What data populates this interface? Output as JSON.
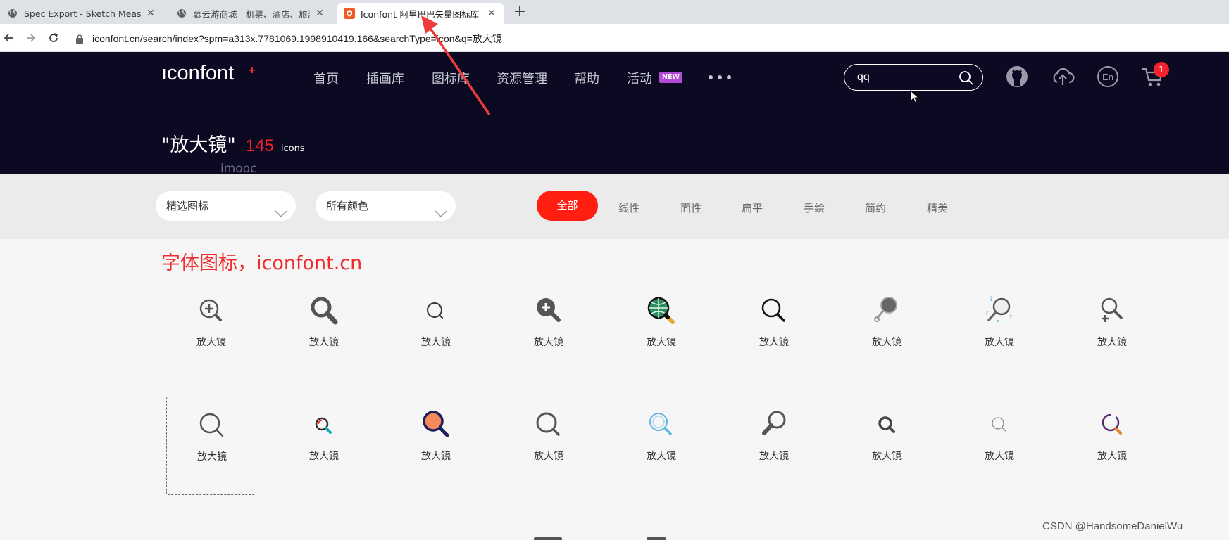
{
  "browser": {
    "tabs": [
      {
        "title": "Spec Export - Sketch Measure",
        "favicon": "globe-icon",
        "active": false
      },
      {
        "title": "慕云游商城 - 机票、酒店、旅游",
        "favicon": "globe-icon",
        "active": false
      },
      {
        "title": "Iconfont-阿里巴巴矢量图标库",
        "favicon": "iconfont-favicon",
        "active": true
      }
    ],
    "new_tab": "+",
    "url": "iconfont.cn/search/index?spm=a313x.7781069.1998910419.166&searchType=icon&q=放大镜"
  },
  "header": {
    "logo": "ıconfont",
    "logo_plus": "+",
    "nav": [
      "首页",
      "插画库",
      "图标库",
      "资源管理",
      "帮助",
      "活动"
    ],
    "new_badge": "NEW",
    "search_value": "qq",
    "cart_count": "1",
    "icons": [
      "github-icon",
      "upload-icon",
      "language-en-icon",
      "cart-icon"
    ]
  },
  "result": {
    "keyword": "\"放大镜\"",
    "count": "145",
    "unit": "icons",
    "watermark": "imooc"
  },
  "filters": {
    "select_type": "精选图标",
    "select_color": "所有颜色",
    "style_tabs": [
      "全部",
      "线性",
      "面性",
      "扁平",
      "手绘",
      "简约",
      "精美"
    ],
    "active_tab": "全部"
  },
  "annotation": "字体图标，iconfont.cn",
  "icons": [
    {
      "label": "放大镜",
      "icon": "magnifier-plus-icon"
    },
    {
      "label": "放大镜",
      "icon": "magnifier-bold-icon"
    },
    {
      "label": "放大镜",
      "icon": "magnifier-thin-icon"
    },
    {
      "label": "放大镜",
      "icon": "magnifier-plus-filled-icon"
    },
    {
      "label": "放大镜",
      "icon": "magnifier-globe-icon"
    },
    {
      "label": "放大镜",
      "icon": "magnifier-outline-icon"
    },
    {
      "label": "放大镜",
      "icon": "magnifier-gray-filled-icon"
    },
    {
      "label": "放大镜",
      "icon": "magnifier-question-icon"
    },
    {
      "label": "放大镜",
      "icon": "magnifier-plus-small-icon"
    },
    {
      "label": "放大镜",
      "icon": "magnifier-line-icon"
    },
    {
      "label": "放大镜",
      "icon": "magnifier-teal-icon"
    },
    {
      "label": "放大镜",
      "icon": "magnifier-orange-icon"
    },
    {
      "label": "放大镜",
      "icon": "magnifier-gray-icon"
    },
    {
      "label": "放大镜",
      "icon": "magnifier-lightblue-icon"
    },
    {
      "label": "放大镜",
      "icon": "magnifier-handle-icon"
    },
    {
      "label": "放大镜",
      "icon": "magnifier-small-bold-icon"
    },
    {
      "label": "放大镜",
      "icon": "magnifier-tiny-icon"
    },
    {
      "label": "放大镜",
      "icon": "magnifier-purple-icon"
    }
  ],
  "footer_watermark": "CSDN @HandsomeDanielWu",
  "colors": {
    "header_bg": "#0b0a22",
    "accent_red": "#ff1e0f",
    "annotation_red": "#f02d2d",
    "new_badge": "#b54ad6"
  }
}
